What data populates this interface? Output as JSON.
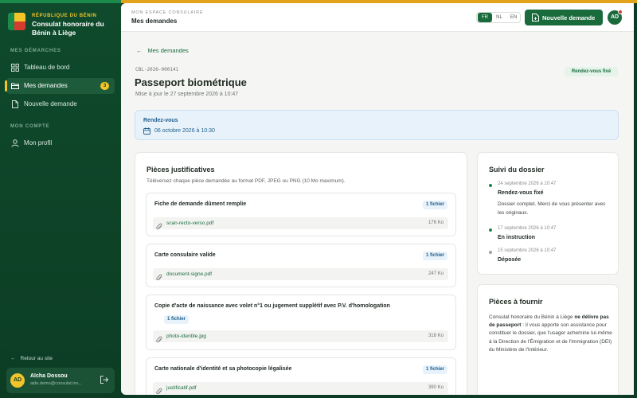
{
  "brand": {
    "country": "RÉPUBLIQUE DU BÉNIN",
    "title": "Consulat honoraire du Bénin à Liège"
  },
  "sidebar": {
    "section_demarches": "MES DÉMARCHES",
    "section_compte": "MON COMPTE",
    "items": [
      {
        "label": "Tableau de bord",
        "icon": "grid-icon",
        "active": false
      },
      {
        "label": "Mes demandes",
        "icon": "folder-icon",
        "active": true,
        "badge": "3"
      },
      {
        "label": "Nouvelle demande",
        "icon": "file-plus-icon",
        "active": false
      },
      {
        "label": "Mon profil",
        "icon": "user-icon",
        "active": false
      }
    ],
    "back_to_site": "Retour au site",
    "user": {
      "initials": "AD",
      "name": "Aïcha Dossou",
      "email": "aide.demo@consulat.inv..."
    }
  },
  "header": {
    "section": "MON ESPACE CONSULAIRE",
    "title": "Mes demandes",
    "languages": [
      "FR",
      "NL",
      "EN"
    ],
    "active_language": "FR",
    "new_request_label": "Nouvelle demande",
    "avatar_initials": "AD"
  },
  "request": {
    "back_label": "Mes demandes",
    "reference": "CBL-2026-000141",
    "status": "Rendez-vous fixé",
    "title": "Passeport biométrique",
    "updated": "Mise à jour le 27 septembre 2026 à 10:47",
    "appointment": {
      "label": "Rendez-vous",
      "date": "06 octobre 2026 à 10:30"
    }
  },
  "pieces": {
    "title": "Pièces justificatives",
    "subtitle": "Téléversez chaque pièce demandée au format PDF, JPEG ou PNG (10 Mo maximum).",
    "documents": [
      {
        "name": "Fiche de demande dûment remplie",
        "count": "1 fichier",
        "file": "scan-recto-verso.pdf",
        "size": "176 Ko"
      },
      {
        "name": "Carte consulaire valide",
        "count": "1 fichier",
        "file": "document-signe.pdf",
        "size": "247 Ko"
      },
      {
        "name": "Copie d'acte de naissance avec volet n°1 ou jugement supplétif avec P.V. d'homologation",
        "count": "1 fichier",
        "file": "photo-identite.jpg",
        "size": "318 Ko"
      },
      {
        "name": "Carte nationale d'identité et sa photocopie légalisée",
        "count": "1 fichier",
        "file": "justificatif.pdf",
        "size": "390 Ko"
      }
    ]
  },
  "suivi": {
    "title": "Suivi du dossier",
    "events": [
      {
        "date": "24 septembre 2026 à 10:47",
        "title": "Rendez-vous fixé",
        "desc": "Dossier complet. Merci de vous présenter avec les originaux.",
        "color": "#1a8a4a"
      },
      {
        "date": "17 septembre 2026 à 10:47",
        "title": "En instruction",
        "desc": "",
        "color": "#1a8a4a"
      },
      {
        "date": "15 septembre 2026 à 10:47",
        "title": "Déposée",
        "desc": "",
        "color": "#9aa39d"
      }
    ]
  },
  "fournir": {
    "title": "Pièces à fournir",
    "text_before": "Consulat honoraire du Bénin à Liège ",
    "text_bold": "ne délivre pas de passeport",
    "text_after": " : il vous apporte son assistance pour constituer le dossier, que l'usager achemine lui-même à la Direction de l'Émigration et de l'Immigration (DEI) du Ministère de l'Intérieur."
  },
  "colors": {
    "brand_green": "#1a6b3c",
    "sidebar_bg": "#0f4a2c",
    "accent_yellow": "#f1c52a",
    "flag_red": "#d63b2f",
    "info_blue": "#1f5f8a"
  }
}
